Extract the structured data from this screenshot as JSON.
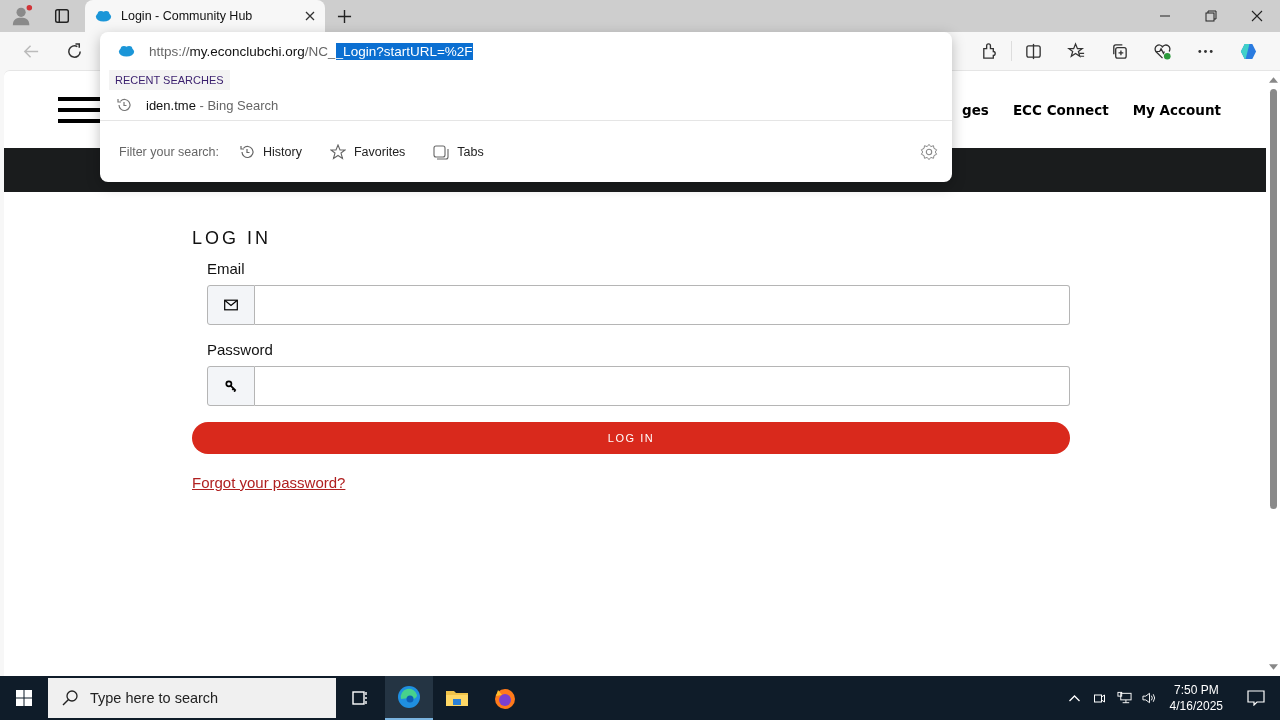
{
  "browser": {
    "tabs": [
      {
        "title": "Login - Community Hub",
        "selected": true
      }
    ],
    "address_popup": {
      "url": [
        {
          "kind": "dim",
          "text": "https://"
        },
        {
          "kind": "host",
          "text": "my.econclubchi.org"
        },
        {
          "kind": "dim",
          "text": "/NC_"
        },
        {
          "kind": "selected",
          "text": "_Login?startURL=%2F"
        }
      ],
      "section_label": "RECENT SEARCHES",
      "suggestions": [
        {
          "query": "iden.tme",
          "source": "- Bing Search"
        }
      ],
      "filter_label": "Filter your search:",
      "filters": [
        {
          "kind": "history",
          "label": "History"
        },
        {
          "kind": "favorites",
          "label": "Favorites"
        },
        {
          "kind": "tabs",
          "label": "Tabs"
        }
      ]
    }
  },
  "site": {
    "nav": [
      "ges",
      "ECC Connect",
      "My Account"
    ],
    "heading": "LOG IN",
    "fields": [
      {
        "kind": "email",
        "label": "Email"
      },
      {
        "kind": "password",
        "label": "Password"
      }
    ],
    "submit": "LOG IN",
    "forgot_link": "Forgot your password?"
  },
  "taskbar": {
    "search_placeholder": "Type here to search",
    "time": "7:50 PM",
    "date": "4/16/2025"
  }
}
